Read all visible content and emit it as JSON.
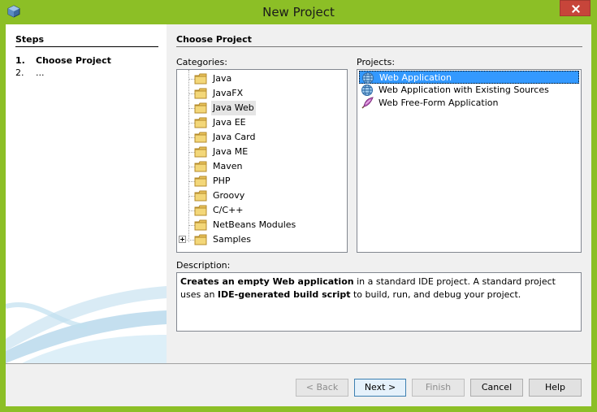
{
  "window": {
    "title": "New Project"
  },
  "steps": {
    "header": "Steps",
    "items": [
      {
        "num": "1.",
        "label": "Choose Project"
      },
      {
        "num": "2.",
        "label": "..."
      }
    ]
  },
  "content": {
    "header": "Choose Project",
    "categories_label": "Categories:",
    "projects_label": "Projects:",
    "categories": [
      "Java",
      "JavaFX",
      "Java Web",
      "Java EE",
      "Java Card",
      "Java ME",
      "Maven",
      "PHP",
      "Groovy",
      "C/C++",
      "NetBeans Modules",
      "Samples"
    ],
    "selected_category": "Java Web",
    "projects": [
      "Web Application",
      "Web Application with Existing Sources",
      "Web Free-Form Application"
    ],
    "selected_project": "Web Application",
    "description_label": "Description:",
    "description": {
      "b1": "Creates an empty Web application",
      "t1": " in a standard IDE project. A standard project uses an ",
      "b2": "IDE-generated build script",
      "t2": " to build, run, and debug your project."
    }
  },
  "buttons": {
    "back": "< Back",
    "next": "Next >",
    "finish": "Finish",
    "cancel": "Cancel",
    "help": "Help"
  },
  "colors": {
    "frame": "#8cbf26",
    "selection": "#3399ff",
    "folder": "#e8c15a"
  }
}
